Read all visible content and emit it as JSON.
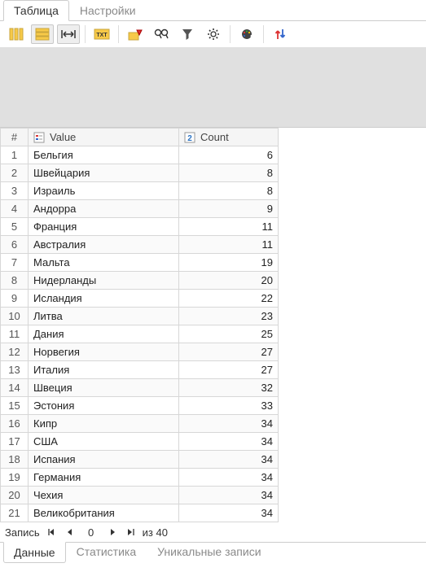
{
  "topTabs": {
    "table": "Таблица",
    "settings": "Настройки"
  },
  "columns": {
    "idx": "#",
    "value": "Value",
    "count": "Count"
  },
  "rows": [
    {
      "idx": 1,
      "value": "Бельгия",
      "count": 6
    },
    {
      "idx": 2,
      "value": "Швейцария",
      "count": 8
    },
    {
      "idx": 3,
      "value": "Израиль",
      "count": 8
    },
    {
      "idx": 4,
      "value": "Андорра",
      "count": 9
    },
    {
      "idx": 5,
      "value": "Франция",
      "count": 11
    },
    {
      "idx": 6,
      "value": "Австралия",
      "count": 11
    },
    {
      "idx": 7,
      "value": "Мальта",
      "count": 19
    },
    {
      "idx": 8,
      "value": "Нидерланды",
      "count": 20
    },
    {
      "idx": 9,
      "value": "Исландия",
      "count": 22
    },
    {
      "idx": 10,
      "value": "Литва",
      "count": 23
    },
    {
      "idx": 11,
      "value": "Дания",
      "count": 25
    },
    {
      "idx": 12,
      "value": "Норвегия",
      "count": 27
    },
    {
      "idx": 13,
      "value": "Италия",
      "count": 27
    },
    {
      "idx": 14,
      "value": "Швеция",
      "count": 32
    },
    {
      "idx": 15,
      "value": "Эстония",
      "count": 33
    },
    {
      "idx": 16,
      "value": "Кипр",
      "count": 34
    },
    {
      "idx": 17,
      "value": "США",
      "count": 34
    },
    {
      "idx": 18,
      "value": "Испания",
      "count": 34
    },
    {
      "idx": 19,
      "value": "Германия",
      "count": 34
    },
    {
      "idx": 20,
      "value": "Чехия",
      "count": 34
    },
    {
      "idx": 21,
      "value": "Великобритания",
      "count": 34
    }
  ],
  "pager": {
    "label": "Запись",
    "current": "0",
    "ofLabel": "из",
    "total": "40"
  },
  "bottomTabs": {
    "data": "Данные",
    "stats": "Статистика",
    "unique": "Уникальные записи"
  }
}
